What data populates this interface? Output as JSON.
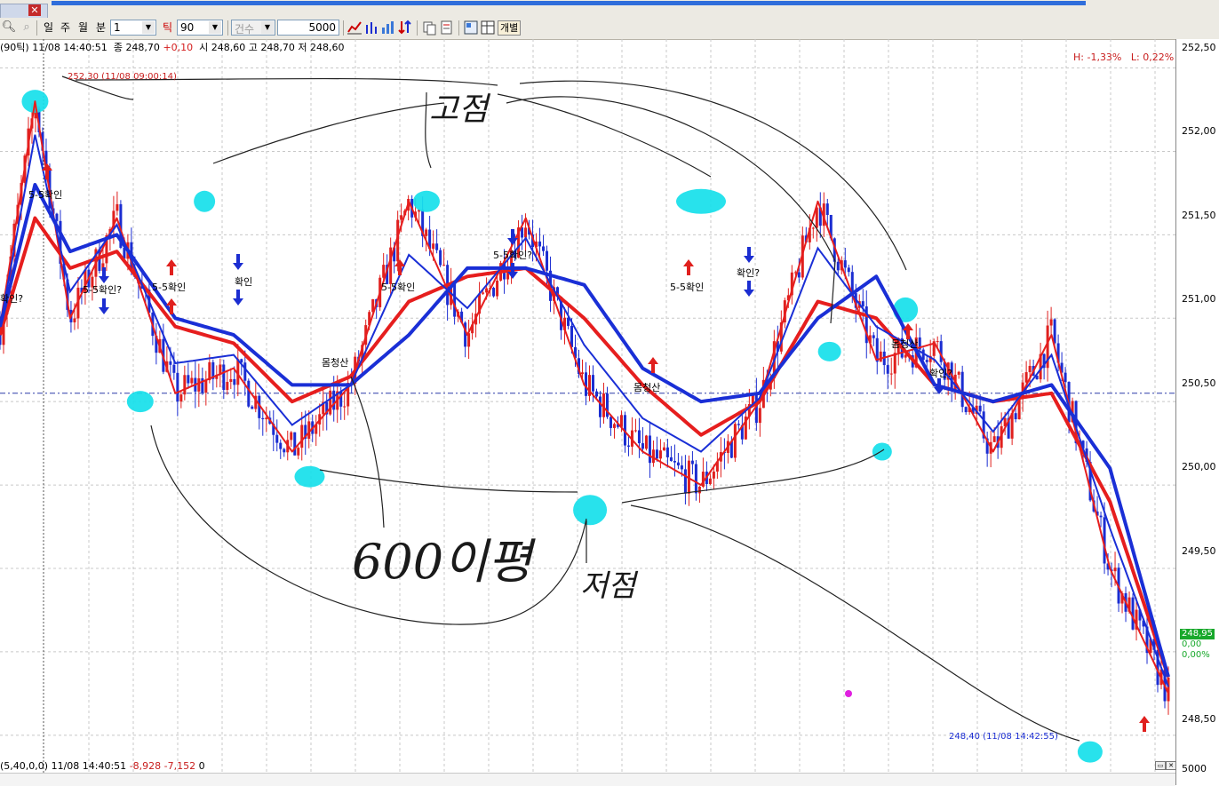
{
  "titlebar": {
    "close_glyph": "✕"
  },
  "toolbar": {
    "period_buttons": [
      "일",
      "주",
      "월",
      "분"
    ],
    "interval_value": "1",
    "tick_label": "틱",
    "tick_value": "90",
    "count_label": "건수",
    "count_value": "5000",
    "individual_button": "개별"
  },
  "info": {
    "prefix": "(90틱)",
    "datetime": "11/08 14:40:51",
    "close_label": "종",
    "close_value": "248,70",
    "change": "+0,10",
    "open_label": "시",
    "open_value": "248,60",
    "high_label": "고",
    "high_value": "248,70",
    "low_label": "저",
    "low_value": "248,60"
  },
  "hl": {
    "high": "H: -1,33%",
    "low": "L: 0,22%"
  },
  "annotations": {
    "max": "252,30 (11/08 09:00:14)",
    "min": "248,40 (11/08 14:42:55)",
    "signals": [
      "5-5확인",
      "5-5확인?",
      "5-5확인",
      "확인",
      "5-5확인",
      "5-5확인?",
      "5-5확인",
      "확인?",
      "확인?",
      "몸청산",
      "몸청산",
      "몸청산",
      "확인?"
    ]
  },
  "handwriting": {
    "high_points": "고점",
    "low_points": "저점",
    "six_hundred": "600이평"
  },
  "price_badges": {
    "last": "248,95",
    "chg": "0,00",
    "pct": "0,00%"
  },
  "bottom": {
    "indicator": "(5,40,0,0)",
    "datetime": "11/08 14:40:51",
    "v1": "-8,928",
    "v2": "-7,152",
    "v3": "0",
    "axis_value": "5000"
  },
  "colors": {
    "up": "#e0201e",
    "down": "#1b2dd1",
    "ma_red": "#e61e1e",
    "ma_blue": "#1a2fd6",
    "highlight": "#16e0ea",
    "grid": "#c8c8c8",
    "refline": "#2a3aa8"
  },
  "chart_data": {
    "type": "line",
    "title": "",
    "xlabel": "",
    "ylabel": "",
    "ylim": [
      248.35,
      252.62
    ],
    "y_ticks": [
      "252,50",
      "252,00",
      "251,50",
      "251,00",
      "250,50",
      "250,00",
      "249,50",
      "248,50"
    ],
    "reference_level": 250.55,
    "series": [
      {
        "x": [
          0,
          3,
          6,
          10,
          15,
          20,
          25,
          30,
          35,
          40,
          45,
          50,
          55,
          60,
          65,
          70,
          75,
          80,
          85,
          90,
          95,
          100
        ],
        "values": [
          250.95,
          252.3,
          251.0,
          251.6,
          250.55,
          250.7,
          250.2,
          250.6,
          251.7,
          250.9,
          251.6,
          250.6,
          250.2,
          250.0,
          250.5,
          251.7,
          250.75,
          250.85,
          250.2,
          250.9,
          249.5,
          248.75
        ]
      },
      {
        "x": [
          0,
          3,
          6,
          10,
          15,
          20,
          25,
          30,
          35,
          40,
          45,
          50,
          55,
          60,
          65,
          70,
          75,
          80,
          85,
          90,
          95,
          100
        ],
        "values": [
          250.9,
          251.6,
          251.3,
          251.4,
          250.95,
          250.85,
          250.5,
          250.65,
          251.1,
          251.25,
          251.3,
          251.0,
          250.6,
          250.3,
          250.5,
          251.1,
          251.0,
          250.6,
          250.5,
          250.55,
          249.9,
          248.85
        ]
      },
      {
        "x": [
          0,
          3,
          6,
          10,
          15,
          20,
          25,
          30,
          35,
          40,
          45,
          50,
          55,
          60,
          65,
          70,
          75,
          80,
          85,
          90,
          95,
          100
        ],
        "values": [
          250.95,
          251.8,
          251.4,
          251.5,
          251.0,
          250.9,
          250.6,
          250.6,
          250.9,
          251.3,
          251.3,
          251.2,
          250.7,
          250.5,
          250.55,
          251.0,
          251.25,
          250.6,
          250.5,
          250.6,
          250.1,
          248.85
        ]
      }
    ],
    "extremes": {
      "high": 252.3,
      "low": 248.4
    }
  }
}
